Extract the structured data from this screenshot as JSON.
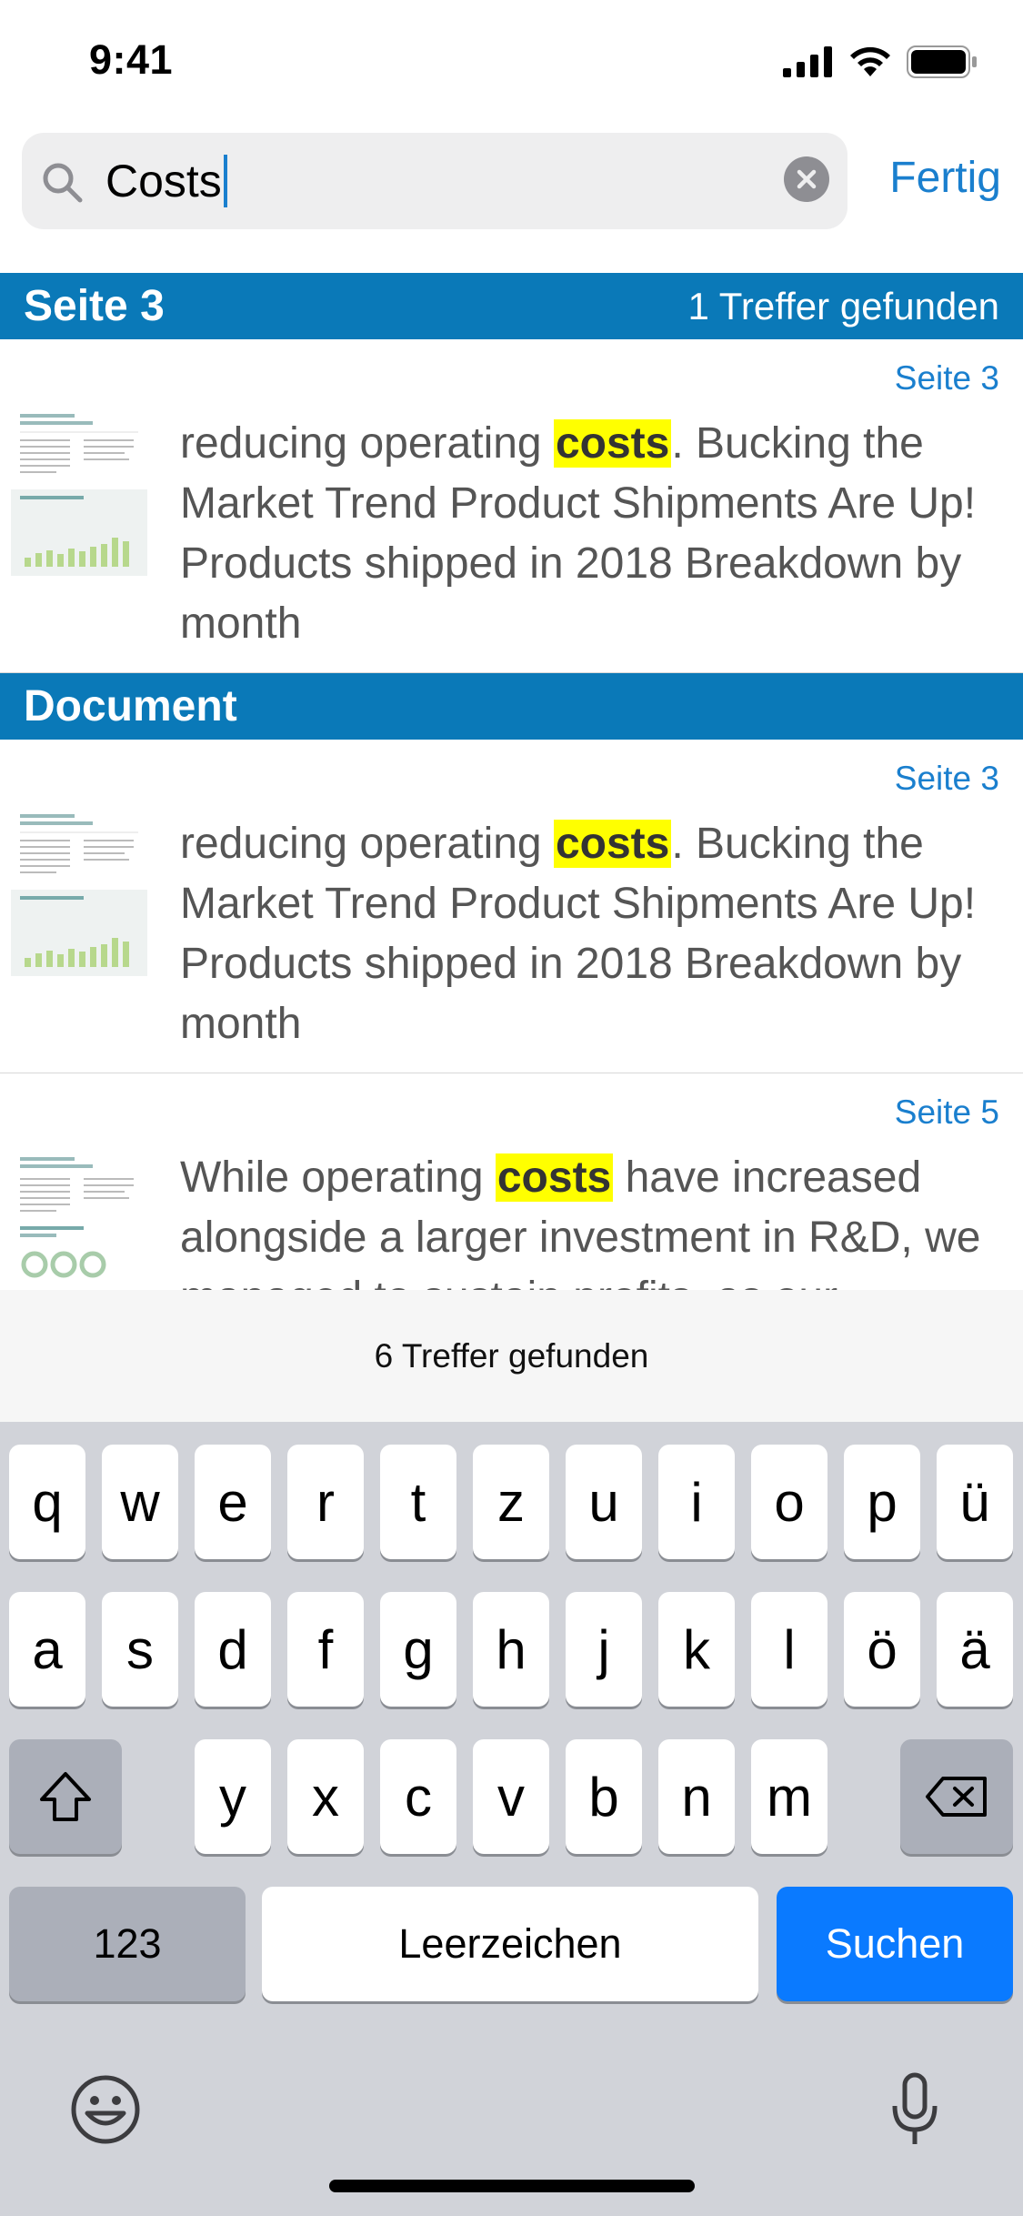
{
  "status_bar": {
    "time": "9:41"
  },
  "search": {
    "query": "Costs",
    "done_label": "Fertig"
  },
  "sections": [
    {
      "title": "Seite 3",
      "count": "1 Treffer gefunden",
      "results": [
        {
          "page": "Seite 3",
          "before": "reducing operating ",
          "match": "costs",
          "after": ". Bucking the Market Trend Product Shipments Are Up! Products shipped in 2018 Breakdown by month"
        }
      ]
    },
    {
      "title": "Document",
      "count": "",
      "results": [
        {
          "page": "Seite 3",
          "before": "reducing operating ",
          "match": "costs",
          "after": ". Bucking the Market Trend Product Shipments Are Up! Products shipped in 2018 Breakdown by month"
        },
        {
          "page": "Seite 5",
          "before": "While operating ",
          "match": "costs",
          "after": " have increased alongside a larger investment in R&D, we managed to sustain profits, as our"
        }
      ]
    }
  ],
  "info_bar": {
    "text": "6 Treffer gefunden"
  },
  "keyboard": {
    "row1": [
      "q",
      "w",
      "e",
      "r",
      "t",
      "z",
      "u",
      "i",
      "o",
      "p",
      "ü"
    ],
    "row2": [
      "a",
      "s",
      "d",
      "f",
      "g",
      "h",
      "j",
      "k",
      "l",
      "ö",
      "ä"
    ],
    "row3": [
      "y",
      "x",
      "c",
      "v",
      "b",
      "n",
      "m"
    ],
    "numbers_key": "123",
    "space_key": "Leerzeichen",
    "search_key": "Suchen"
  },
  "colors": {
    "accent": "#1a7fce",
    "section_header": "#0a79b8",
    "highlight": "#ffff00",
    "keyboard_bg": "#d1d3d9",
    "search_key": "#0a7aff"
  }
}
